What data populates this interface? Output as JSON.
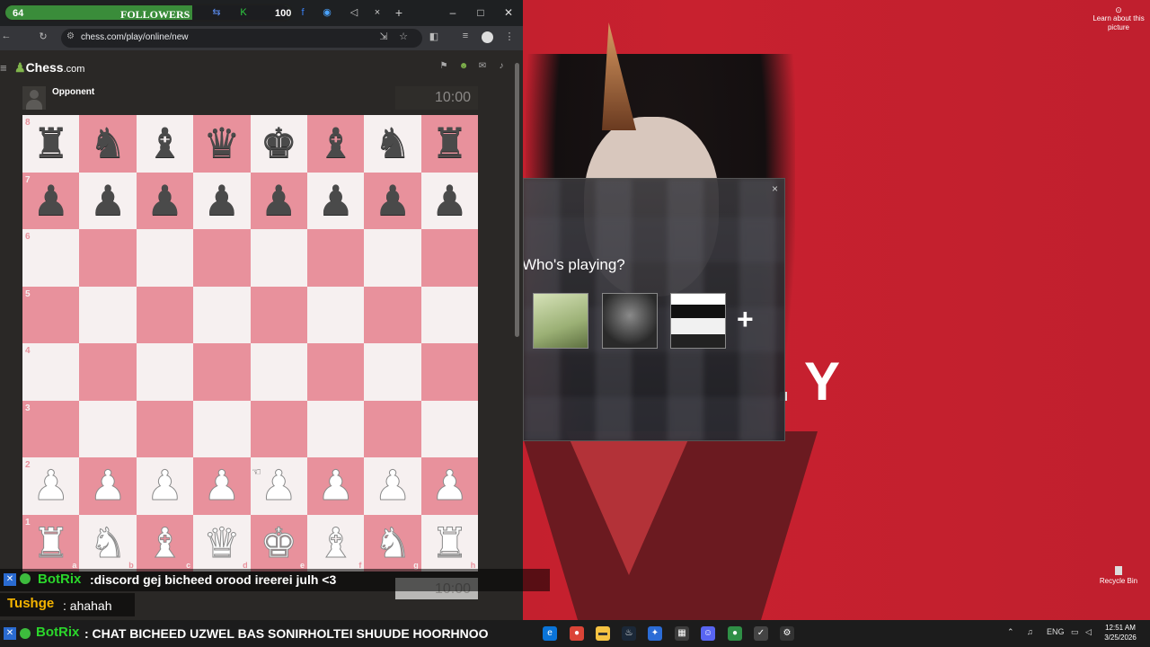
{
  "browser": {
    "followers_widget": {
      "count": "64",
      "label": "FOLLOWERS",
      "goal": "100"
    },
    "url": "chess.com/play/online/new"
  },
  "chesscom": {
    "logo_main": "Chess",
    "logo_suffix": ".com",
    "opponent_name": "Opponent",
    "opponent_clock": "10:00",
    "player_clock": "10:00",
    "ranks": [
      "8",
      "7",
      "6",
      "5",
      "4",
      "3",
      "2",
      "1"
    ],
    "files": [
      "a",
      "b",
      "c",
      "d",
      "e",
      "f",
      "g",
      "h"
    ],
    "position": [
      [
        "r",
        "n",
        "b",
        "q",
        "k",
        "b",
        "n",
        "r"
      ],
      [
        "p",
        "p",
        "p",
        "p",
        "p",
        "p",
        "p",
        "p"
      ],
      [
        "",
        "",
        "",
        "",
        "",
        "",
        "",
        ""
      ],
      [
        "",
        "",
        "",
        "",
        "",
        "",
        "",
        ""
      ],
      [
        "",
        "",
        "",
        "",
        "",
        "",
        "",
        ""
      ],
      [
        "",
        "",
        "",
        "",
        "",
        "",
        "",
        ""
      ],
      [
        "P",
        "P",
        "P",
        "P",
        "P",
        "P",
        "P",
        "P"
      ],
      [
        "R",
        "N",
        "B",
        "Q",
        "K",
        "B",
        "N",
        "R"
      ]
    ]
  },
  "chat": {
    "line1": {
      "user": "BotRix",
      "message": ":discord gej bicheed orood ireerei julh <3"
    },
    "line2": {
      "user": "Tushge",
      "message": ": ahahah"
    },
    "line3": {
      "user": "BotRix",
      "message": ": CHAT BICHEED UZWEL BAS SONIRHOLTEI SHUUDE HOORHNOO"
    }
  },
  "popup": {
    "title": "Who's playing?",
    "add_label": "+",
    "close_label": "×"
  },
  "desktop": {
    "learn_text": "Learn about this picture",
    "recycle_bin": "Recycle Bin",
    "wallpaper_letter": "Y",
    "tray_lang": "ENG",
    "time": "12:51 AM",
    "date": "3/25/2026"
  },
  "colors": {
    "light_square": "#f6f0f0",
    "dark_square": "#e8919c",
    "chesscom_green": "#81b64c"
  },
  "icons": [
    "hamburger-icon",
    "back-icon",
    "reload-icon",
    "tune-icon",
    "install-icon",
    "star-icon",
    "extensions-icon",
    "tab-search-icon",
    "profile-icon",
    "kebab-icon"
  ]
}
